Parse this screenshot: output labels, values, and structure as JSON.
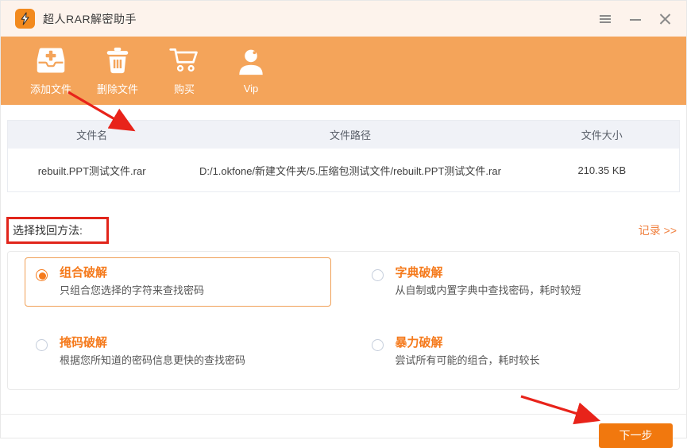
{
  "app": {
    "title": "超人RAR解密助手"
  },
  "toolbar": {
    "items": [
      {
        "label": "添加文件",
        "icon": "inbox-plus-icon"
      },
      {
        "label": "删除文件",
        "icon": "trash-icon"
      },
      {
        "label": "购买",
        "icon": "cart-icon"
      },
      {
        "label": "Vip",
        "icon": "user-icon"
      }
    ]
  },
  "file_table": {
    "headers": {
      "name": "文件名",
      "path": "文件路径",
      "size": "文件大小"
    },
    "rows": [
      {
        "name": "rebuilt.PPT测试文件.rar",
        "path": "D:/1.okfone/新建文件夹/5.压缩包测试文件/rebuilt.PPT测试文件.rar",
        "size": "210.35 KB"
      }
    ]
  },
  "method_section": {
    "label": "选择找回方法:",
    "records_link": "记录 >>",
    "options": [
      {
        "title": "组合破解",
        "desc": "只组合您选择的字符来查找密码",
        "selected": true
      },
      {
        "title": "字典破解",
        "desc": "从自制或内置字典中查找密码，耗时较短",
        "selected": false
      },
      {
        "title": "掩码破解",
        "desc": "根据您所知道的密码信息更快的查找密码",
        "selected": false
      },
      {
        "title": "暴力破解",
        "desc": "尝试所有可能的组合，耗时较长",
        "selected": false
      }
    ]
  },
  "footer": {
    "next_button": "下一步"
  },
  "colors": {
    "accent": "#f57a1c",
    "toolbar_bg": "#f4a45a",
    "titlebar_bg": "#fdf3ec",
    "button_bg": "#f1780e",
    "annotation_red": "#e8231a"
  }
}
